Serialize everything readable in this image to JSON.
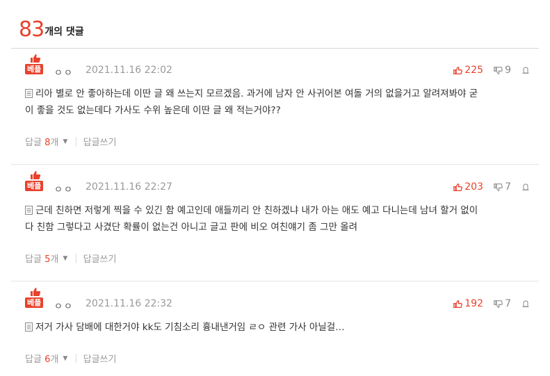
{
  "header": {
    "count": "83",
    "label": "개의 댓글"
  },
  "badge_label": "베플",
  "comments": [
    {
      "author": "ㅇㅇ",
      "date": "2021.11.16 22:02",
      "up": "225",
      "down": "9",
      "text_line1": "리아 별로 안 좋아하는데 이딴 글 왜 쓰는지 모르겠음. 과거에 남자 안 사귀어본 여돌 거의 없을거고 알려져봐야 굳",
      "text_line2": "이 좋을 것도 없는데다 가사도 수위 높은데 이딴 글 왜 적는거야??",
      "reply_prefix": "답글",
      "reply_count": "8",
      "reply_suffix": "개",
      "write_reply": "답글쓰기"
    },
    {
      "author": "ㅇㅇ",
      "date": "2021.11.16 22:27",
      "up": "203",
      "down": "7",
      "text_line1": "근데 친하면 저렇게 찍을 수 있긴 함 예고인데 애들끼리 안 친하겠냐 내가 아는 애도 예고 다니는데 남녀 할거 없이",
      "text_line2": "다 친함 그렇다고 사겼단 확률이 없는건 아니고 글고 판에 비오 여친얘기 좀 그만 올려",
      "reply_prefix": "답글",
      "reply_count": "5",
      "reply_suffix": "개",
      "write_reply": "답글쓰기"
    },
    {
      "author": "ㅇㅇ",
      "date": "2021.11.16 22:32",
      "up": "192",
      "down": "7",
      "text_line1": "저거 가사 담배에 대한거야 kk도 기침소리 흉내낸거임 ㄹㅇ 관련 가사 아닐걸…",
      "text_line2": "",
      "reply_prefix": "답글",
      "reply_count": "6",
      "reply_suffix": "개",
      "write_reply": "답글쓰기"
    }
  ],
  "colors": {
    "accent": "#e8412c",
    "muted": "#999999"
  },
  "icons": [
    "thumb-up-icon",
    "thumb-down-icon",
    "report-icon",
    "document-icon",
    "caret-down-icon"
  ]
}
